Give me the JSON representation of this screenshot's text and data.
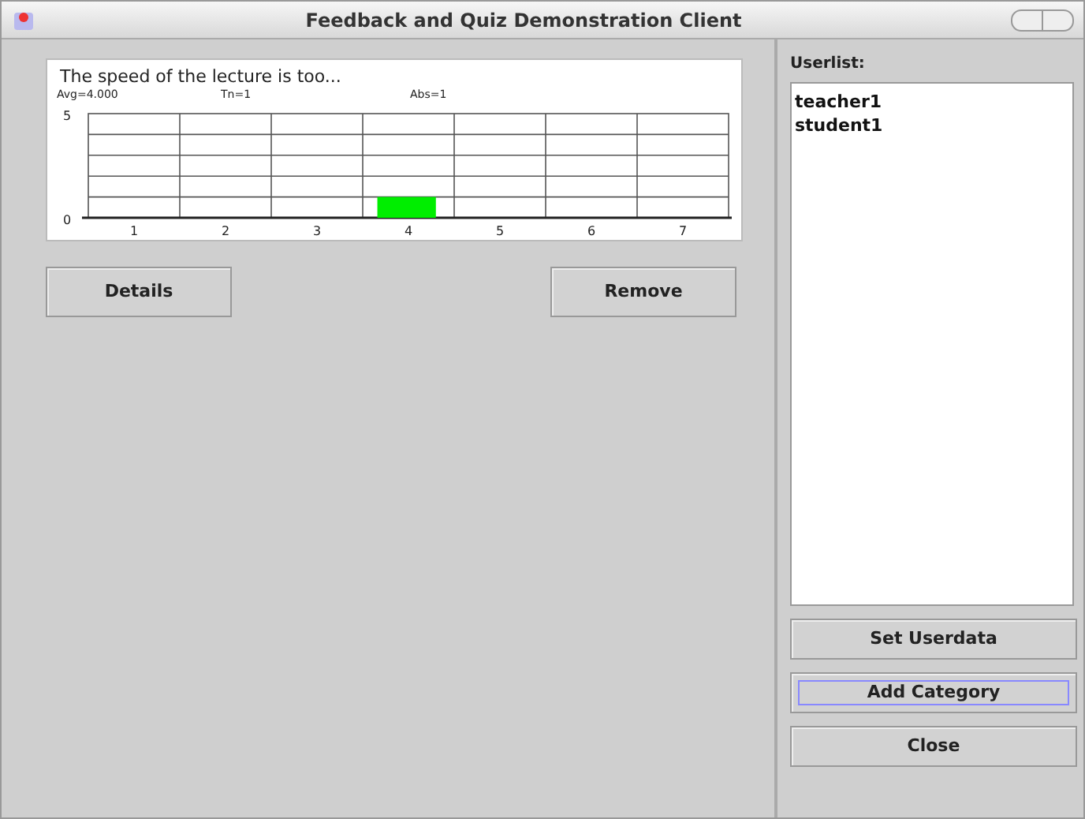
{
  "window": {
    "title": "Feedback and Quiz Demonstration Client"
  },
  "category": {
    "title": "The speed of the lecture is too...",
    "stats": [
      "Avg=4.000",
      "Tn=1",
      "Abs=1"
    ],
    "chart_data": {
      "type": "bar",
      "categories": [
        "1",
        "2",
        "3",
        "4",
        "5",
        "6",
        "7"
      ],
      "series": [
        {
          "color": "#00ee00",
          "values": [
            0,
            0,
            0,
            1,
            0,
            0,
            0
          ]
        }
      ],
      "ylim": [
        0,
        5
      ],
      "yticks": [
        0,
        5
      ]
    }
  },
  "category_buttons": [
    {
      "label": "Details",
      "focused": false
    },
    {
      "label": "Remove",
      "focused": false
    }
  ],
  "userlist": {
    "label": "Userlist:",
    "users": [
      "teacher1",
      "student1"
    ]
  },
  "side_buttons": [
    {
      "label": "Set Userdata",
      "focused": false
    },
    {
      "label": "Add Category",
      "focused": true
    },
    {
      "label": "Close",
      "focused": false
    }
  ]
}
